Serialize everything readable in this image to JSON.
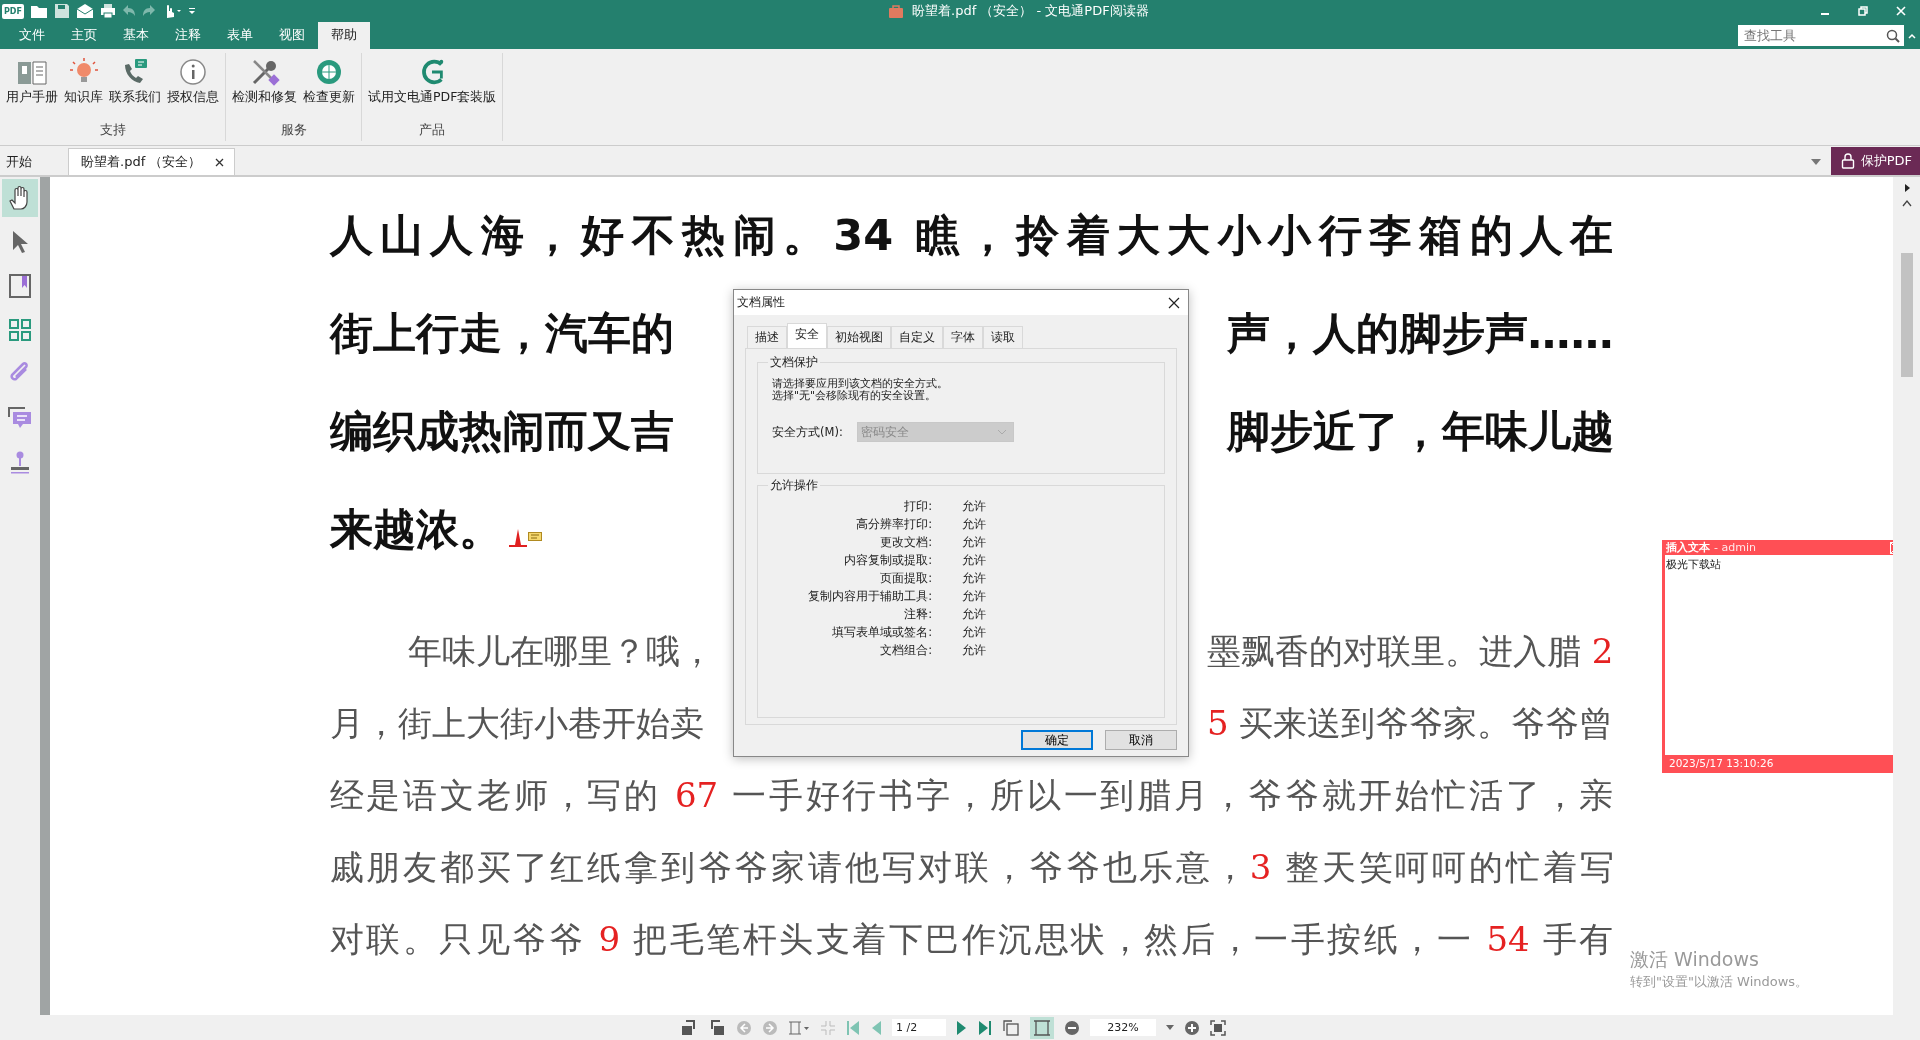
{
  "window": {
    "logo": "PDF",
    "title": "盼望着.pdf （安全） - 文电通PDF阅读器"
  },
  "menu_tabs": [
    {
      "label": "文件",
      "selected": false
    },
    {
      "label": "主页",
      "selected": false
    },
    {
      "label": "基本",
      "selected": false
    },
    {
      "label": "注释",
      "selected": false
    },
    {
      "label": "表单",
      "selected": false
    },
    {
      "label": "视图",
      "selected": false
    },
    {
      "label": "帮助",
      "selected": true
    }
  ],
  "search": {
    "placeholder": "查找工具"
  },
  "ribbon_groups": [
    {
      "label": "支持",
      "buttons": [
        {
          "label": "用户手册",
          "kind": "manual"
        },
        {
          "label": "知识库",
          "kind": "bulb"
        },
        {
          "label": "联系我们",
          "kind": "phone"
        },
        {
          "label": "授权信息",
          "kind": "info"
        }
      ]
    },
    {
      "label": "服务",
      "buttons": [
        {
          "label": "检测和修复",
          "kind": "tools"
        },
        {
          "label": "检查更新",
          "kind": "update"
        }
      ]
    },
    {
      "label": "产品",
      "buttons": [
        {
          "label": "试用文电通PDF套装版",
          "kind": "brand"
        }
      ]
    }
  ],
  "doc_tabs": [
    {
      "label": "开始",
      "selected": false,
      "closable": false
    },
    {
      "label": "盼望着.pdf （安全）",
      "selected": true,
      "closable": true
    }
  ],
  "protect_button": "保护PDF",
  "left_tools": [
    {
      "kind": "hand",
      "selected": true
    },
    {
      "kind": "select",
      "selected": false
    },
    {
      "kind": "bookmark",
      "selected": false
    },
    {
      "kind": "thumbnails",
      "selected": false
    },
    {
      "kind": "attachment",
      "selected": false
    },
    {
      "kind": "comment",
      "selected": false
    },
    {
      "kind": "stamp",
      "selected": false
    }
  ],
  "document": {
    "lines": [
      {
        "kind": "heading",
        "annotated": false,
        "parts": [
          [
            {
              "text": "人山人海，好不热闹。34 瞧，拎着大大小小行李箱的人在",
              "kind": "text"
            }
          ]
        ]
      },
      {
        "kind": "heading",
        "annotated": false,
        "parts": [
          [
            {
              "text": "街上行走，汽车的",
              "kind": "text"
            }
          ],
          [
            {
              "text": "声，人的脚步声……",
              "kind": "text"
            }
          ]
        ]
      },
      {
        "kind": "heading",
        "annotated": false,
        "parts": [
          [
            {
              "text": "编织成热闹而又吉",
              "kind": "text"
            }
          ],
          [
            {
              "text": "脚步近了，年味儿越",
              "kind": "text"
            }
          ]
        ]
      },
      {
        "kind": "heading",
        "annotated": true,
        "parts": [
          [
            {
              "text": "来越浓。",
              "kind": "text"
            }
          ]
        ]
      },
      {
        "kind": "body",
        "annotated": false,
        "parts": [
          [
            {
              "text": "年味儿在哪里？哦，",
              "kind": "text"
            }
          ],
          [
            {
              "text": "墨飘香的对联里。进入腊 ",
              "kind": "text"
            },
            {
              "text": "2",
              "kind": "number"
            }
          ]
        ]
      },
      {
        "kind": "body",
        "annotated": false,
        "parts": [
          [
            {
              "text": "月，街上大街小巷开始卖",
              "kind": "text"
            }
          ],
          [
            {
              "text": "5",
              "kind": "number"
            },
            {
              "text": " 买来送到爷爷家。爷爷曾",
              "kind": "text"
            }
          ]
        ]
      },
      {
        "kind": "body",
        "annotated": false,
        "parts": [
          [
            {
              "text": "经是语文老师，写的 ",
              "kind": "text"
            },
            {
              "text": "67",
              "kind": "number"
            },
            {
              "text": " 一手好行书字，所以一到腊月，爷爷就开始忙活了，亲",
              "kind": "text"
            }
          ]
        ]
      },
      {
        "kind": "body",
        "annotated": false,
        "parts": [
          [
            {
              "text": "戚朋友都买了红纸拿到爷爷家请他写对联，爷爷也乐意，",
              "kind": "text"
            },
            {
              "text": "3",
              "kind": "number"
            },
            {
              "text": " 整天笑呵呵的忙着写",
              "kind": "text"
            }
          ]
        ]
      },
      {
        "kind": "body",
        "annotated": false,
        "parts": [
          [
            {
              "text": "对联。只见爷爷 ",
              "kind": "text"
            },
            {
              "text": "9",
              "kind": "number"
            },
            {
              "text": " 把毛笔杆头支着下巴作沉思状，然后，一手按纸，一 ",
              "kind": "text"
            },
            {
              "text": "54",
              "kind": "number"
            },
            {
              "text": " 手有",
              "kind": "text"
            }
          ]
        ]
      }
    ]
  },
  "dialog": {
    "title": "文档属性",
    "tabs": [
      {
        "label": "描述",
        "selected": false
      },
      {
        "label": "安全",
        "selected": true
      },
      {
        "label": "初始视图",
        "selected": false
      },
      {
        "label": "自定义",
        "selected": false
      },
      {
        "label": "字体",
        "selected": false
      },
      {
        "label": "读取",
        "selected": false
      }
    ],
    "protection": {
      "legend": "文档保护",
      "lines": [
        "请选择要应用到该文档的安全方式。",
        "选择\"无\"会移除现有的安全设置。"
      ],
      "method_label": "安全方式(M):",
      "method_value": "密码安全",
      "method_disabled": true
    },
    "permissions": {
      "legend": "允许操作",
      "rows": [
        {
          "label": "打印:",
          "value": "允许"
        },
        {
          "label": "高分辨率打印:",
          "value": "允许"
        },
        {
          "label": "更改文档:",
          "value": "允许"
        },
        {
          "label": "内容复制或提取:",
          "value": "允许"
        },
        {
          "label": "页面提取:",
          "value": "允许"
        },
        {
          "label": "复制内容用于辅助工具:",
          "value": "允许"
        },
        {
          "label": "注释:",
          "value": "允许"
        },
        {
          "label": "填写表单域或签名:",
          "value": "允许"
        },
        {
          "label": "文档组合:",
          "value": "允许"
        }
      ]
    },
    "buttons": [
      {
        "label": "确定",
        "default": true
      },
      {
        "label": "取消",
        "default": false
      }
    ]
  },
  "note": {
    "title": "插入文本",
    "author": "- admin",
    "body": "极光下载站",
    "date": "2023/5/17 13:10:26",
    "color": "#ff4f55"
  },
  "activation": {
    "title": "激活 Windows",
    "hint": "转到\"设置\"以激活 Windows。"
  },
  "status_bar": {
    "page": "1 /2",
    "zoom": "232%"
  }
}
